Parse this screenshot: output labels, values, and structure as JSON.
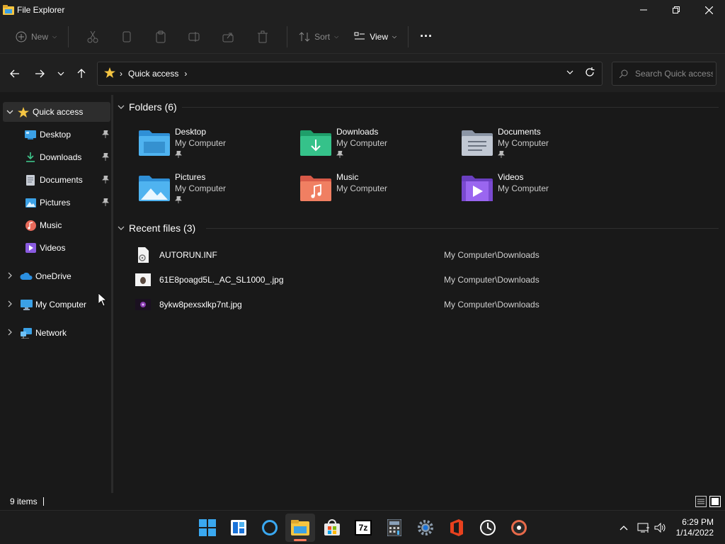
{
  "window": {
    "title": "File Explorer"
  },
  "toolbar": {
    "new_label": "New",
    "sort_label": "Sort",
    "view_label": "View",
    "more_label": "···"
  },
  "address": {
    "crumb": "Quick access",
    "search_placeholder": "Search Quick access"
  },
  "sidebar": {
    "quick_access": "Quick access",
    "items": [
      {
        "label": "Desktop",
        "pinned": true
      },
      {
        "label": "Downloads",
        "pinned": true
      },
      {
        "label": "Documents",
        "pinned": true
      },
      {
        "label": "Pictures",
        "pinned": true
      },
      {
        "label": "Music",
        "pinned": false
      },
      {
        "label": "Videos",
        "pinned": false
      }
    ],
    "onedrive": "OneDrive",
    "my_computer": "My Computer",
    "network": "Network"
  },
  "folders": {
    "header": "Folders (6)",
    "items": [
      {
        "name": "Desktop",
        "location": "My Computer",
        "pinned": true
      },
      {
        "name": "Downloads",
        "location": "My Computer",
        "pinned": true
      },
      {
        "name": "Documents",
        "location": "My Computer",
        "pinned": true
      },
      {
        "name": "Pictures",
        "location": "My Computer",
        "pinned": true
      },
      {
        "name": "Music",
        "location": "My Computer",
        "pinned": false
      },
      {
        "name": "Videos",
        "location": "My Computer",
        "pinned": false
      }
    ]
  },
  "recent": {
    "header": "Recent files (3)",
    "items": [
      {
        "name": "AUTORUN.INF",
        "path": "My Computer\\Downloads"
      },
      {
        "name": "61E8poagd5L._AC_SL1000_.jpg",
        "path": "My Computer\\Downloads"
      },
      {
        "name": "8ykw8pexsxlkp7nt.jpg",
        "path": "My Computer\\Downloads"
      }
    ]
  },
  "status": {
    "count": "9 items"
  },
  "taskbar": {
    "time": "6:29 PM",
    "date": "1/14/2022",
    "sevenzip_label": "7z"
  },
  "colors": {
    "background": "#191919",
    "chrome": "#202020",
    "accent": "#ff7a5a",
    "folder_blue": "#4fb3f0"
  }
}
